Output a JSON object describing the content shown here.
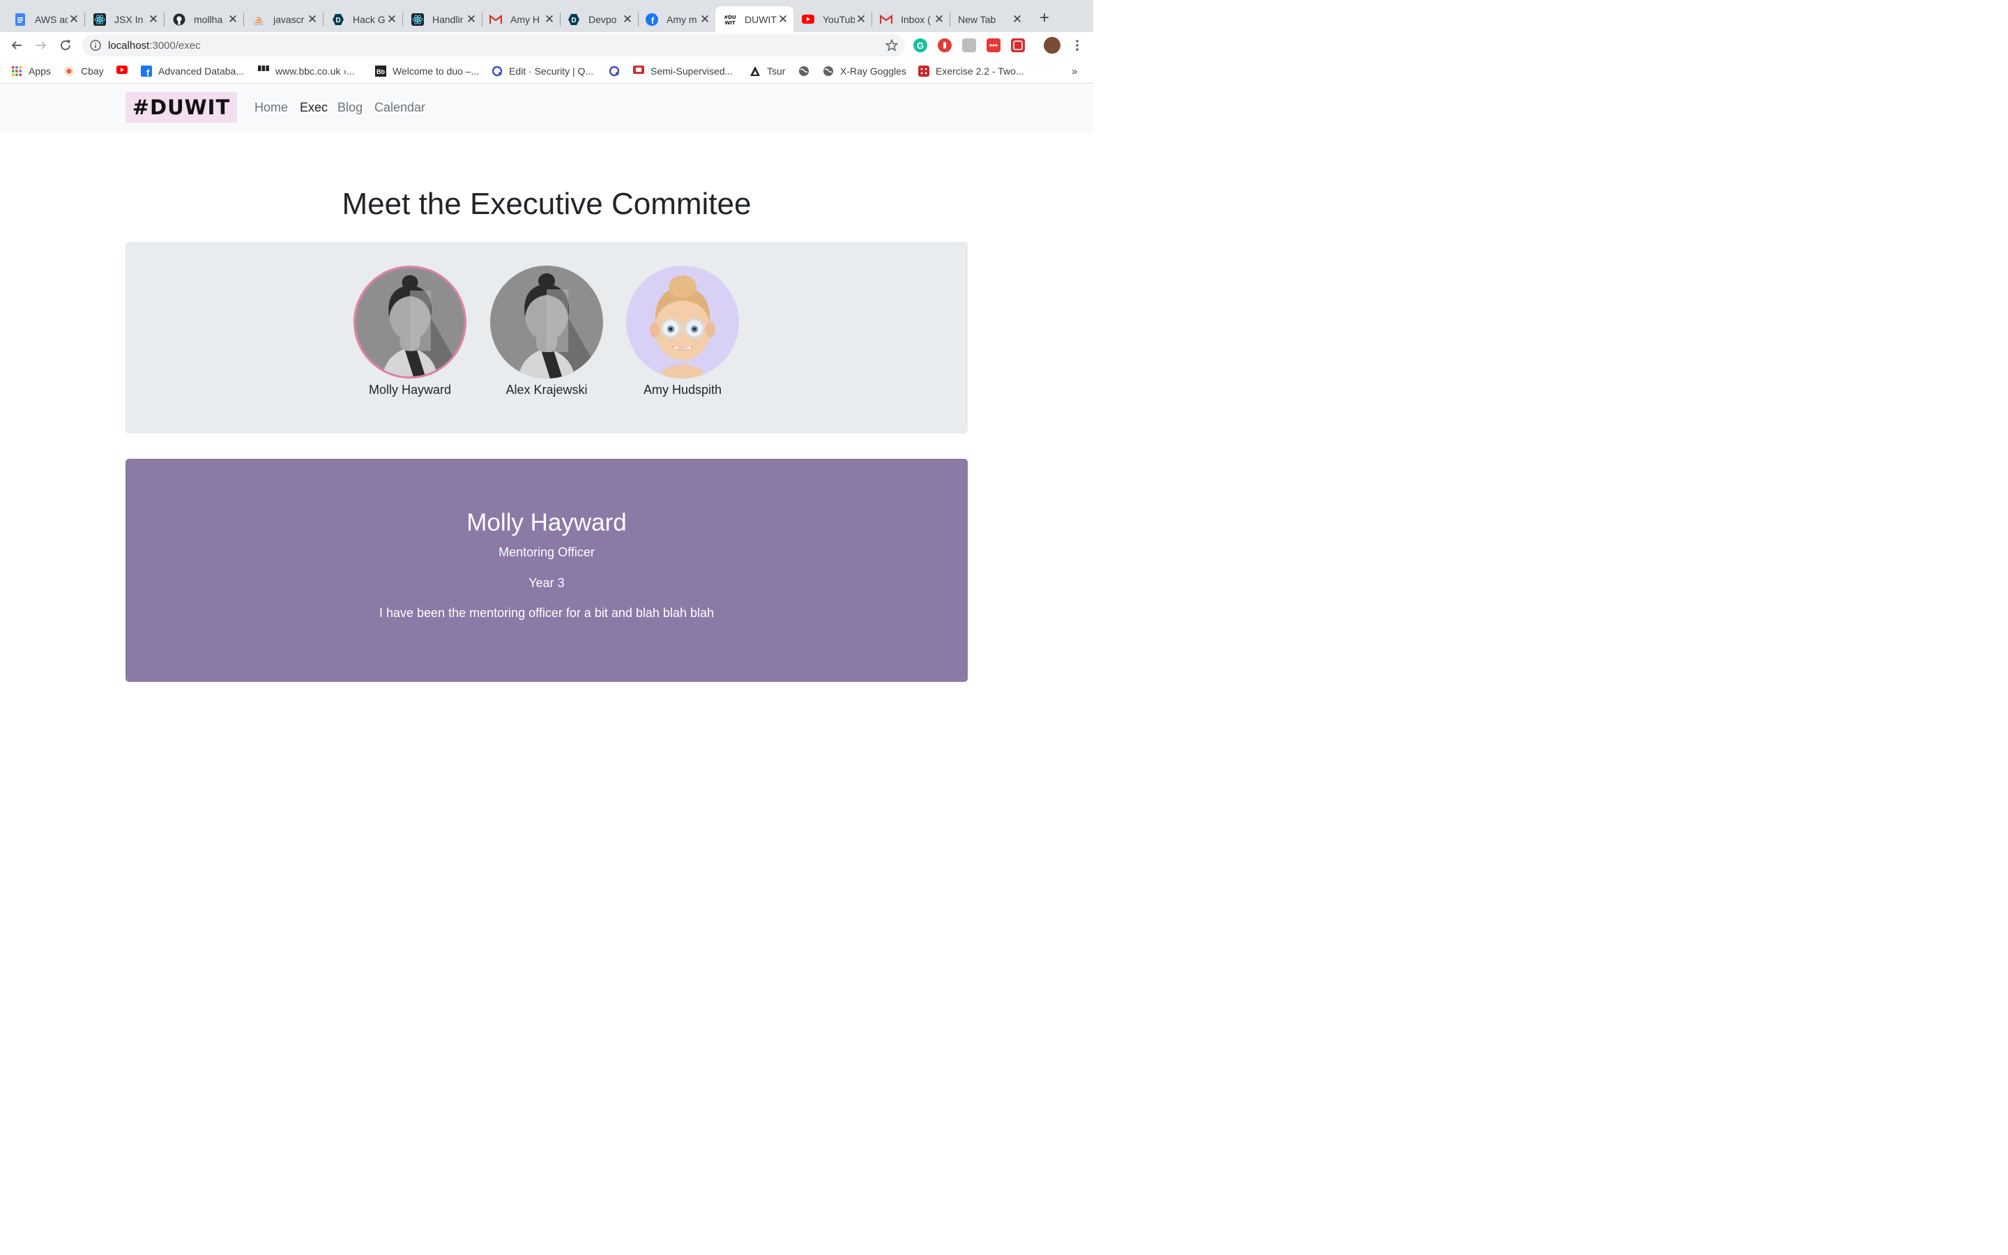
{
  "browser": {
    "tabs": [
      {
        "title": "AWS ac",
        "icon": "google-docs-icon",
        "active": false
      },
      {
        "title": "JSX In",
        "icon": "react-icon",
        "active": false
      },
      {
        "title": "mollha",
        "icon": "github-icon",
        "active": false
      },
      {
        "title": "javascr",
        "icon": "stackoverflow-icon",
        "active": false
      },
      {
        "title": "Hack G",
        "icon": "devpost-icon",
        "active": false
      },
      {
        "title": "Handlir",
        "icon": "react-icon",
        "active": false
      },
      {
        "title": "Amy H",
        "icon": "gmail-icon",
        "active": false
      },
      {
        "title": "Devpo",
        "icon": "devpost-icon",
        "active": false
      },
      {
        "title": "Amy m",
        "icon": "facebook-icon",
        "active": false
      },
      {
        "title": "DUWIT",
        "icon": "duwit-icon",
        "active": true
      },
      {
        "title": "YouTub",
        "icon": "youtube-icon",
        "active": false
      },
      {
        "title": "Inbox (",
        "icon": "gmail-icon",
        "active": false
      },
      {
        "title": "New Tab",
        "icon": "",
        "active": false
      }
    ],
    "address": {
      "host": "localhost",
      "path": ":3000/exec"
    },
    "bookmarks": [
      {
        "label": "Apps",
        "icon": "apps-grid-icon"
      },
      {
        "label": "Cbay",
        "icon": "cbay-icon"
      },
      {
        "label": "",
        "icon": "youtube-icon"
      },
      {
        "label": "Advanced Databa...",
        "icon": "facebook-icon"
      },
      {
        "label": "www.bbc.co.uk ›...",
        "icon": "bbc-icon"
      },
      {
        "label": "Welcome to duo –...",
        "icon": "blackboard-icon"
      },
      {
        "label": "Edit · Security | Q...",
        "icon": "qualys-icon"
      },
      {
        "label": "",
        "icon": "qualys-icon"
      },
      {
        "label": "Semi-Supervised...",
        "icon": "red-bookmark-icon"
      },
      {
        "label": "Tsur",
        "icon": "tsur-icon"
      },
      {
        "label": "",
        "icon": "globe-icon"
      },
      {
        "label": "X-Ray Goggles",
        "icon": "globe-icon"
      },
      {
        "label": "Exercise 2.2 - Two...",
        "icon": "exercise-icon"
      }
    ],
    "more": "»"
  },
  "site": {
    "logo": "#DUWIT",
    "nav": [
      "Home",
      "Exec",
      "Blog",
      "Calendar"
    ],
    "active_nav": "Exec",
    "heading": "Meet the Executive Commitee",
    "members": [
      {
        "name": "Molly Hayward",
        "avatar": "placeholder-avatar",
        "selected": true
      },
      {
        "name": "Alex Krajewski",
        "avatar": "placeholder-avatar",
        "selected": false
      },
      {
        "name": "Amy Hudspith",
        "avatar": "memoji-avatar",
        "selected": false
      }
    ],
    "detail": {
      "name": "Molly Hayward",
      "role": "Mentoring Officer",
      "year": "Year 3",
      "bio": "I have been the mentoring officer for a bit and blah blah blah"
    }
  },
  "colors": {
    "detail_bg": "#8b79a6",
    "selected_ring": "#e17fa8",
    "logo_bg": "#f3dff0"
  }
}
